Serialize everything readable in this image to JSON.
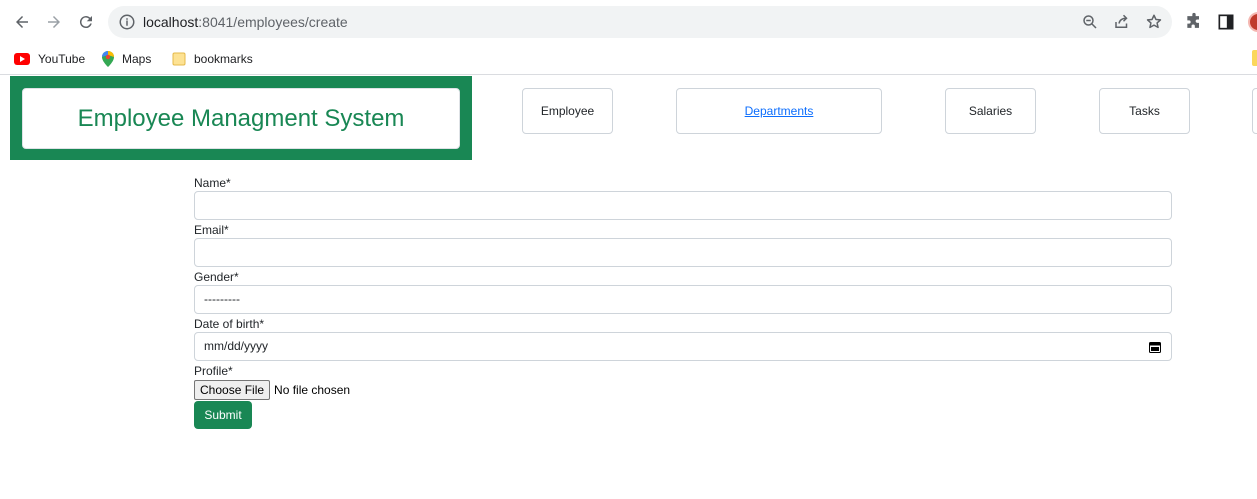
{
  "browser": {
    "url_host": "localhost",
    "url_rest": ":8041/employees/create",
    "bookmarks": [
      {
        "label": "YouTube",
        "icon": "youtube-icon"
      },
      {
        "label": "Maps",
        "icon": "maps-pin-icon"
      },
      {
        "label": "bookmarks",
        "icon": "folder-icon"
      }
    ]
  },
  "header": {
    "brand_title": "Employee Managment System",
    "nav": [
      {
        "label": "Employee"
      },
      {
        "label": "Departments"
      },
      {
        "label": "Salaries"
      },
      {
        "label": "Tasks"
      }
    ]
  },
  "form": {
    "name_label": "Name*",
    "email_label": "Email*",
    "gender_label": "Gender*",
    "gender_value": "---------",
    "dob_label": "Date of birth*",
    "dob_placeholder": "mm/dd/yyyy",
    "profile_label": "Profile*",
    "file_button": "Choose File",
    "file_status": "No file chosen",
    "submit_label": "Submit"
  },
  "colors": {
    "brand": "#198754",
    "link": "#0d6efd"
  }
}
